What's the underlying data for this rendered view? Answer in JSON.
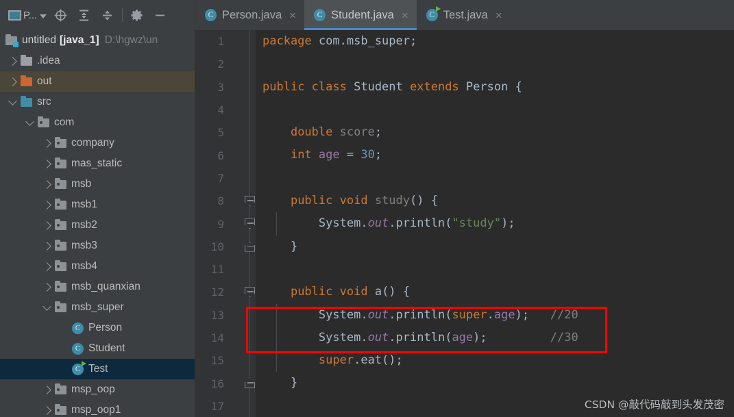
{
  "toolbar": {
    "project_button_label": "P...",
    "icons": [
      {
        "name": "project-select-icon",
        "glyph": "window"
      },
      {
        "name": "locate-target-icon",
        "glyph": "crosshair"
      },
      {
        "name": "expand-all-icon",
        "glyph": "expand"
      },
      {
        "name": "collapse-all-icon",
        "glyph": "collapse"
      },
      {
        "name": "settings-gear-icon",
        "glyph": "gear"
      },
      {
        "name": "hide-panel-icon",
        "glyph": "minus"
      }
    ]
  },
  "project_tree": {
    "root": {
      "name": "untitled",
      "module": "[java_1]",
      "path": "D:\\hgwz\\un"
    },
    "items": [
      {
        "label": ".idea",
        "icon": "folder-gray",
        "indent": 0,
        "arrow": "right",
        "state": "normal"
      },
      {
        "label": "out",
        "icon": "folder-orange",
        "indent": 0,
        "arrow": "right",
        "state": "hover"
      },
      {
        "label": "src",
        "icon": "folder-blue",
        "indent": 0,
        "arrow": "down",
        "state": "normal"
      },
      {
        "label": "com",
        "icon": "package",
        "indent": 1,
        "arrow": "down",
        "state": "normal"
      },
      {
        "label": "company",
        "icon": "package",
        "indent": 2,
        "arrow": "right",
        "state": "normal"
      },
      {
        "label": "mas_static",
        "icon": "package",
        "indent": 2,
        "arrow": "right",
        "state": "normal"
      },
      {
        "label": "msb",
        "icon": "package",
        "indent": 2,
        "arrow": "right",
        "state": "normal"
      },
      {
        "label": "msb1",
        "icon": "package",
        "indent": 2,
        "arrow": "right",
        "state": "normal"
      },
      {
        "label": "msb2",
        "icon": "package",
        "indent": 2,
        "arrow": "right",
        "state": "normal"
      },
      {
        "label": "msb3",
        "icon": "package",
        "indent": 2,
        "arrow": "right",
        "state": "normal"
      },
      {
        "label": "msb4",
        "icon": "package",
        "indent": 2,
        "arrow": "right",
        "state": "normal"
      },
      {
        "label": "msb_quanxian",
        "icon": "package",
        "indent": 2,
        "arrow": "right",
        "state": "normal"
      },
      {
        "label": "msb_super",
        "icon": "package",
        "indent": 2,
        "arrow": "down",
        "state": "normal"
      },
      {
        "label": "Person",
        "icon": "java-class",
        "indent": 3,
        "arrow": "none",
        "state": "normal"
      },
      {
        "label": "Student",
        "icon": "java-class",
        "indent": 3,
        "arrow": "none",
        "state": "normal"
      },
      {
        "label": "Test",
        "icon": "java-class-runnable",
        "indent": 3,
        "arrow": "none",
        "state": "selected"
      },
      {
        "label": "msp_oop",
        "icon": "package",
        "indent": 2,
        "arrow": "right",
        "state": "normal"
      },
      {
        "label": "msp_oop1",
        "icon": "package",
        "indent": 2,
        "arrow": "right",
        "state": "normal"
      }
    ]
  },
  "tabs": [
    {
      "label": "Person.java",
      "icon": "java-class",
      "active": false,
      "close": "×"
    },
    {
      "label": "Student.java",
      "icon": "java-class",
      "active": true,
      "close": "×"
    },
    {
      "label": "Test.java",
      "icon": "java-class-runnable",
      "active": false,
      "close": "×"
    }
  ],
  "editor": {
    "line_numbers": [
      1,
      2,
      3,
      4,
      5,
      6,
      7,
      8,
      9,
      10,
      11,
      12,
      13,
      14,
      15,
      16,
      17
    ],
    "lines": [
      {
        "n": 1,
        "text": "package com.msb_super;"
      },
      {
        "n": 2,
        "text": ""
      },
      {
        "n": 3,
        "text": "public class Student extends Person {"
      },
      {
        "n": 4,
        "text": ""
      },
      {
        "n": 5,
        "text": "    double score;"
      },
      {
        "n": 6,
        "text": "    int age = 30;"
      },
      {
        "n": 7,
        "text": ""
      },
      {
        "n": 8,
        "text": "    public void study() {"
      },
      {
        "n": 9,
        "text": "        System.out.println(\"study\");"
      },
      {
        "n": 10,
        "text": "    }"
      },
      {
        "n": 11,
        "text": ""
      },
      {
        "n": 12,
        "text": "    public void a() {"
      },
      {
        "n": 13,
        "text": "        System.out.println(super.age);   //20"
      },
      {
        "n": 14,
        "text": "        System.out.println(age);         //30"
      },
      {
        "n": 15,
        "text": "        super.eat();"
      },
      {
        "n": 16,
        "text": "    }"
      },
      {
        "n": 17,
        "text": ""
      }
    ],
    "fold_markers": [
      {
        "line": 8,
        "type": "open"
      },
      {
        "line": 9,
        "type": "open"
      },
      {
        "line": 10,
        "type": "close"
      },
      {
        "line": 12,
        "type": "open"
      },
      {
        "line": 16,
        "type": "close"
      }
    ],
    "annotation": {
      "name": "red-highlight-box",
      "color": "#ff0000",
      "covers_lines": [
        13,
        14
      ]
    }
  },
  "watermark": "CSDN @敲代码敲到头发茂密",
  "colors": {
    "panel_bg": "#3c3f41",
    "editor_bg": "#2b2b2b",
    "gutter_bg": "#313335",
    "tab_active_bg": "#4e5254",
    "tab_underline": "#4a88c7",
    "selection_blue": "#0d293e",
    "hover_brown": "#4b4637",
    "keyword": "#cc7832",
    "string": "#6a8759",
    "number": "#6897bb",
    "field": "#9876aa",
    "plain": "#a9b7c6",
    "comment": "#808080",
    "accent_red": "#ff0000"
  }
}
